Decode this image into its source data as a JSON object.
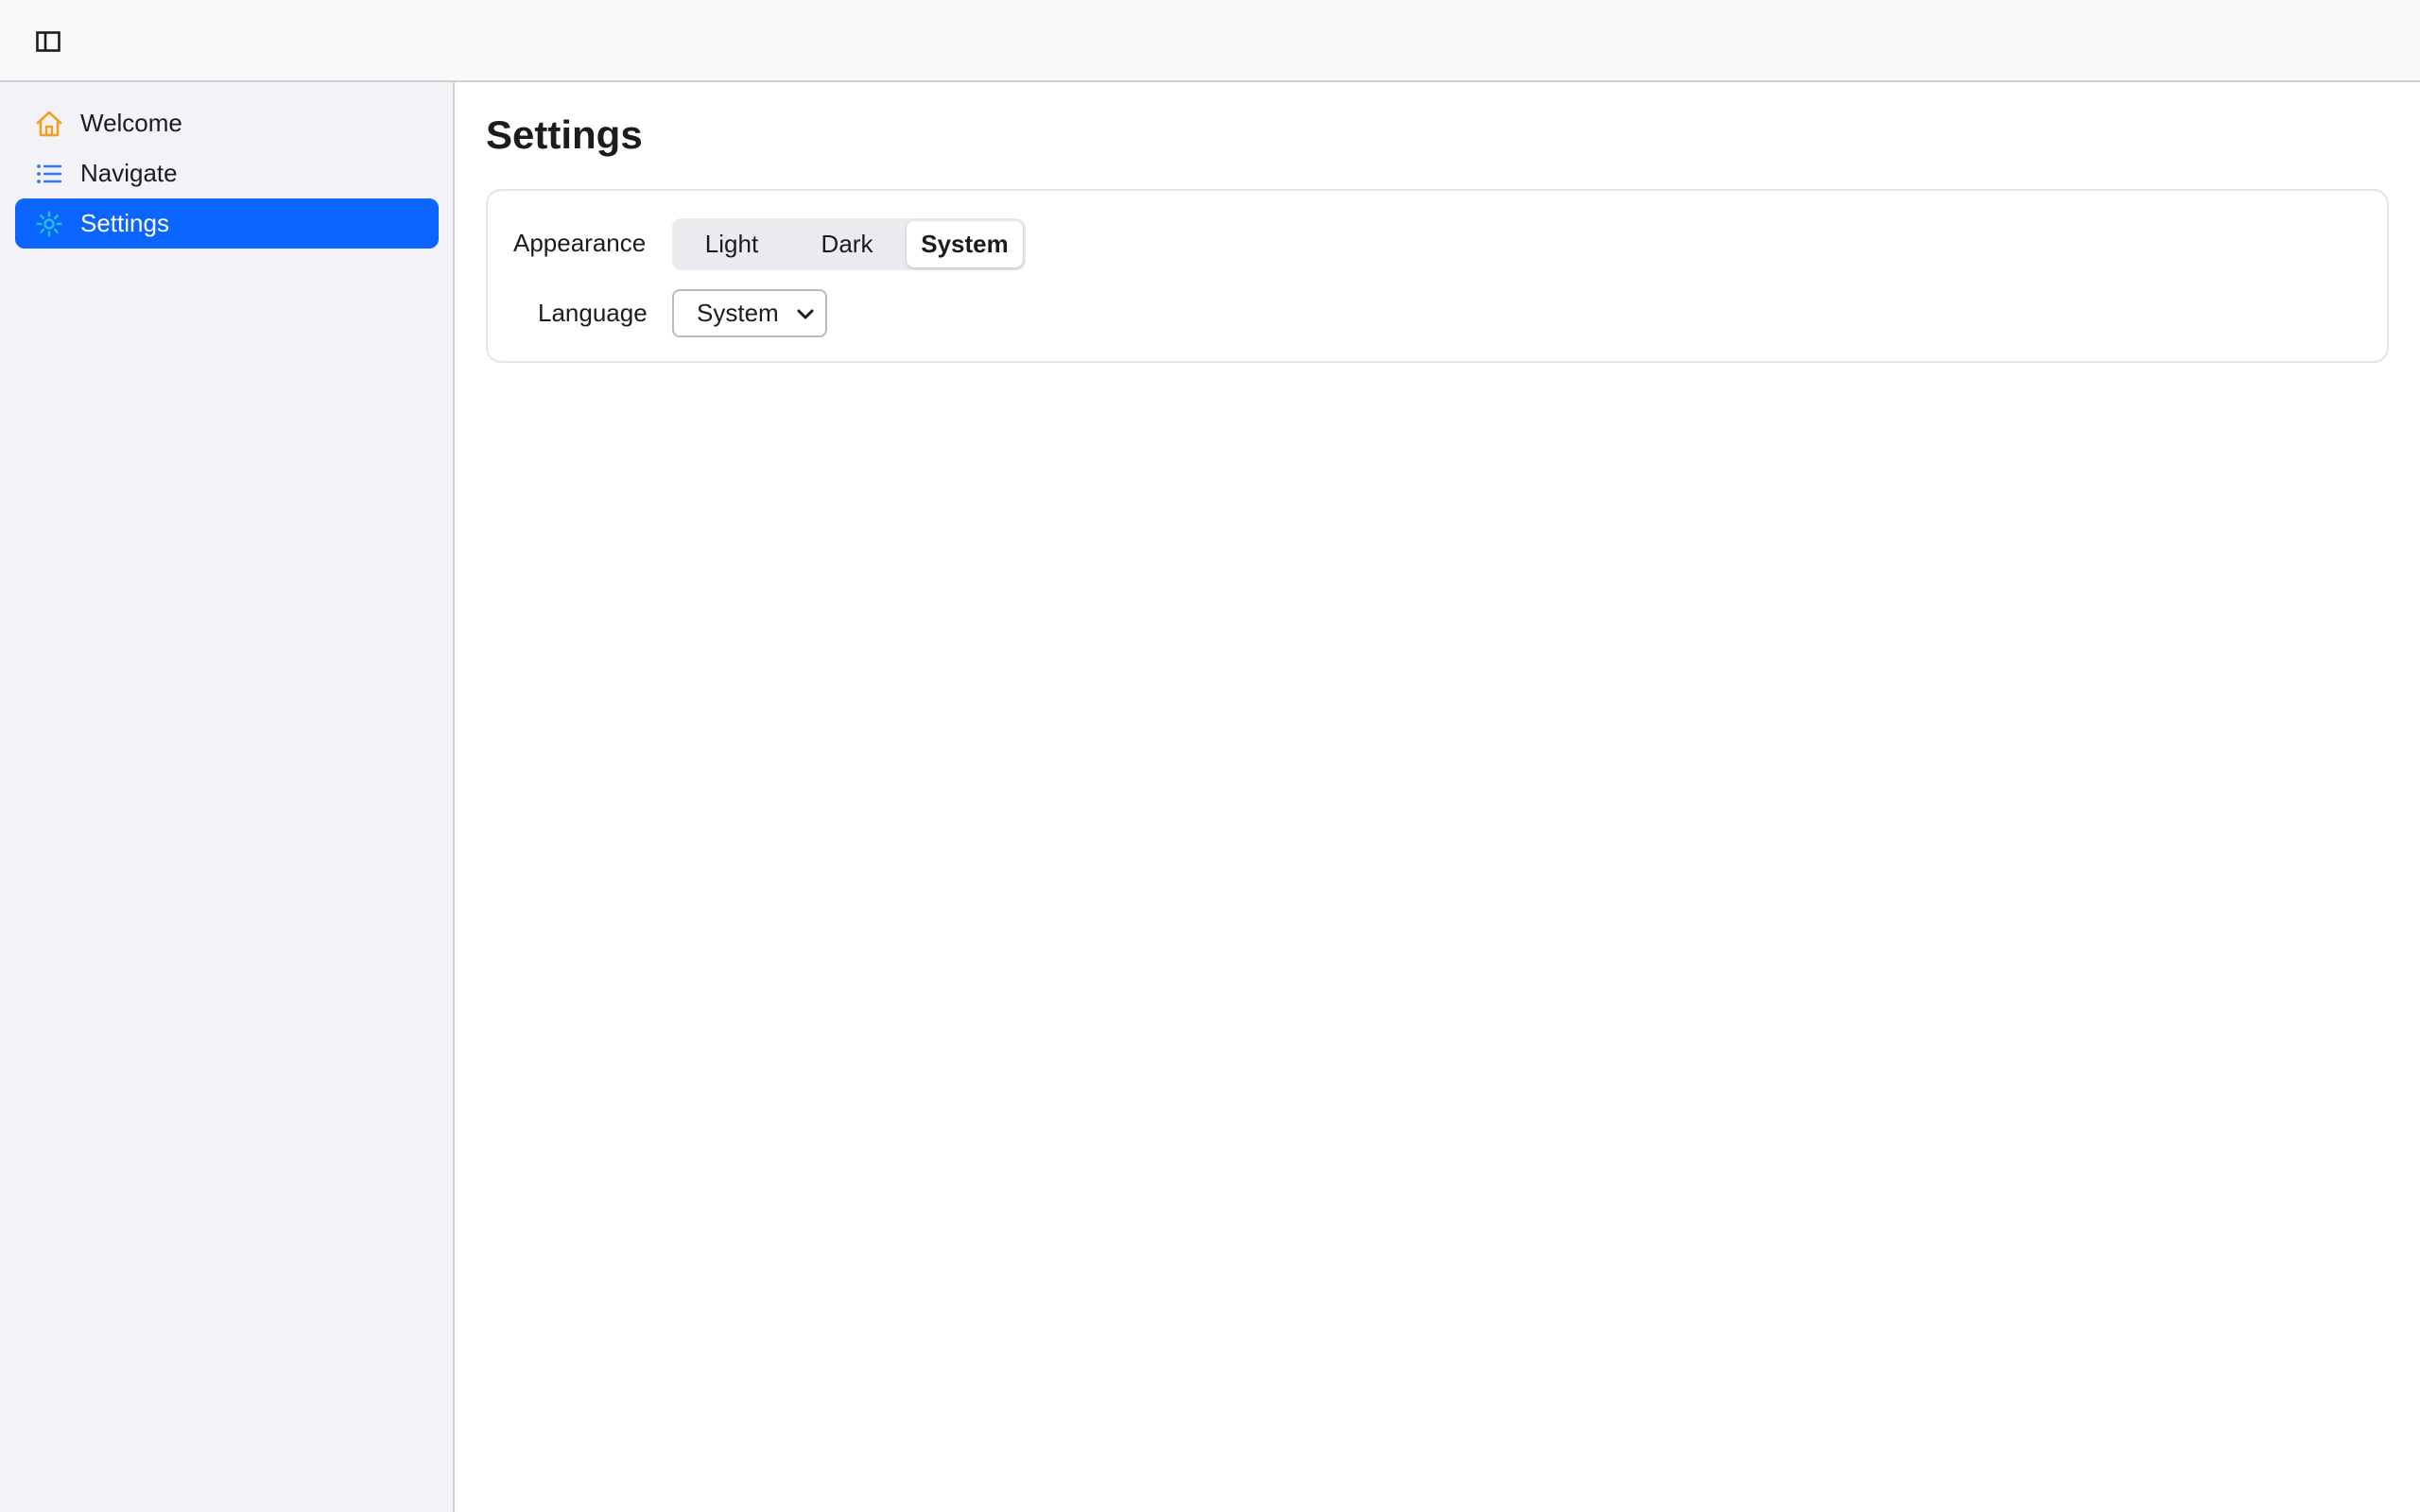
{
  "toolbar": {
    "sidebar_toggle_icon": "sidebar-toggle-icon"
  },
  "sidebar": {
    "items": [
      {
        "label": "Welcome",
        "icon": "home-icon",
        "icon_color": "#f0a020",
        "active": false
      },
      {
        "label": "Navigate",
        "icon": "list-icon",
        "icon_color": "#3478f6",
        "active": false
      },
      {
        "label": "Settings",
        "icon": "gear-icon",
        "icon_color": "#22c3d6",
        "active": true
      }
    ],
    "active_color": "#0a66ff"
  },
  "main": {
    "title": "Settings",
    "appearance": {
      "label": "Appearance",
      "options": [
        "Light",
        "Dark",
        "System"
      ],
      "selected": "System"
    },
    "language": {
      "label": "Language",
      "value": "System"
    }
  }
}
